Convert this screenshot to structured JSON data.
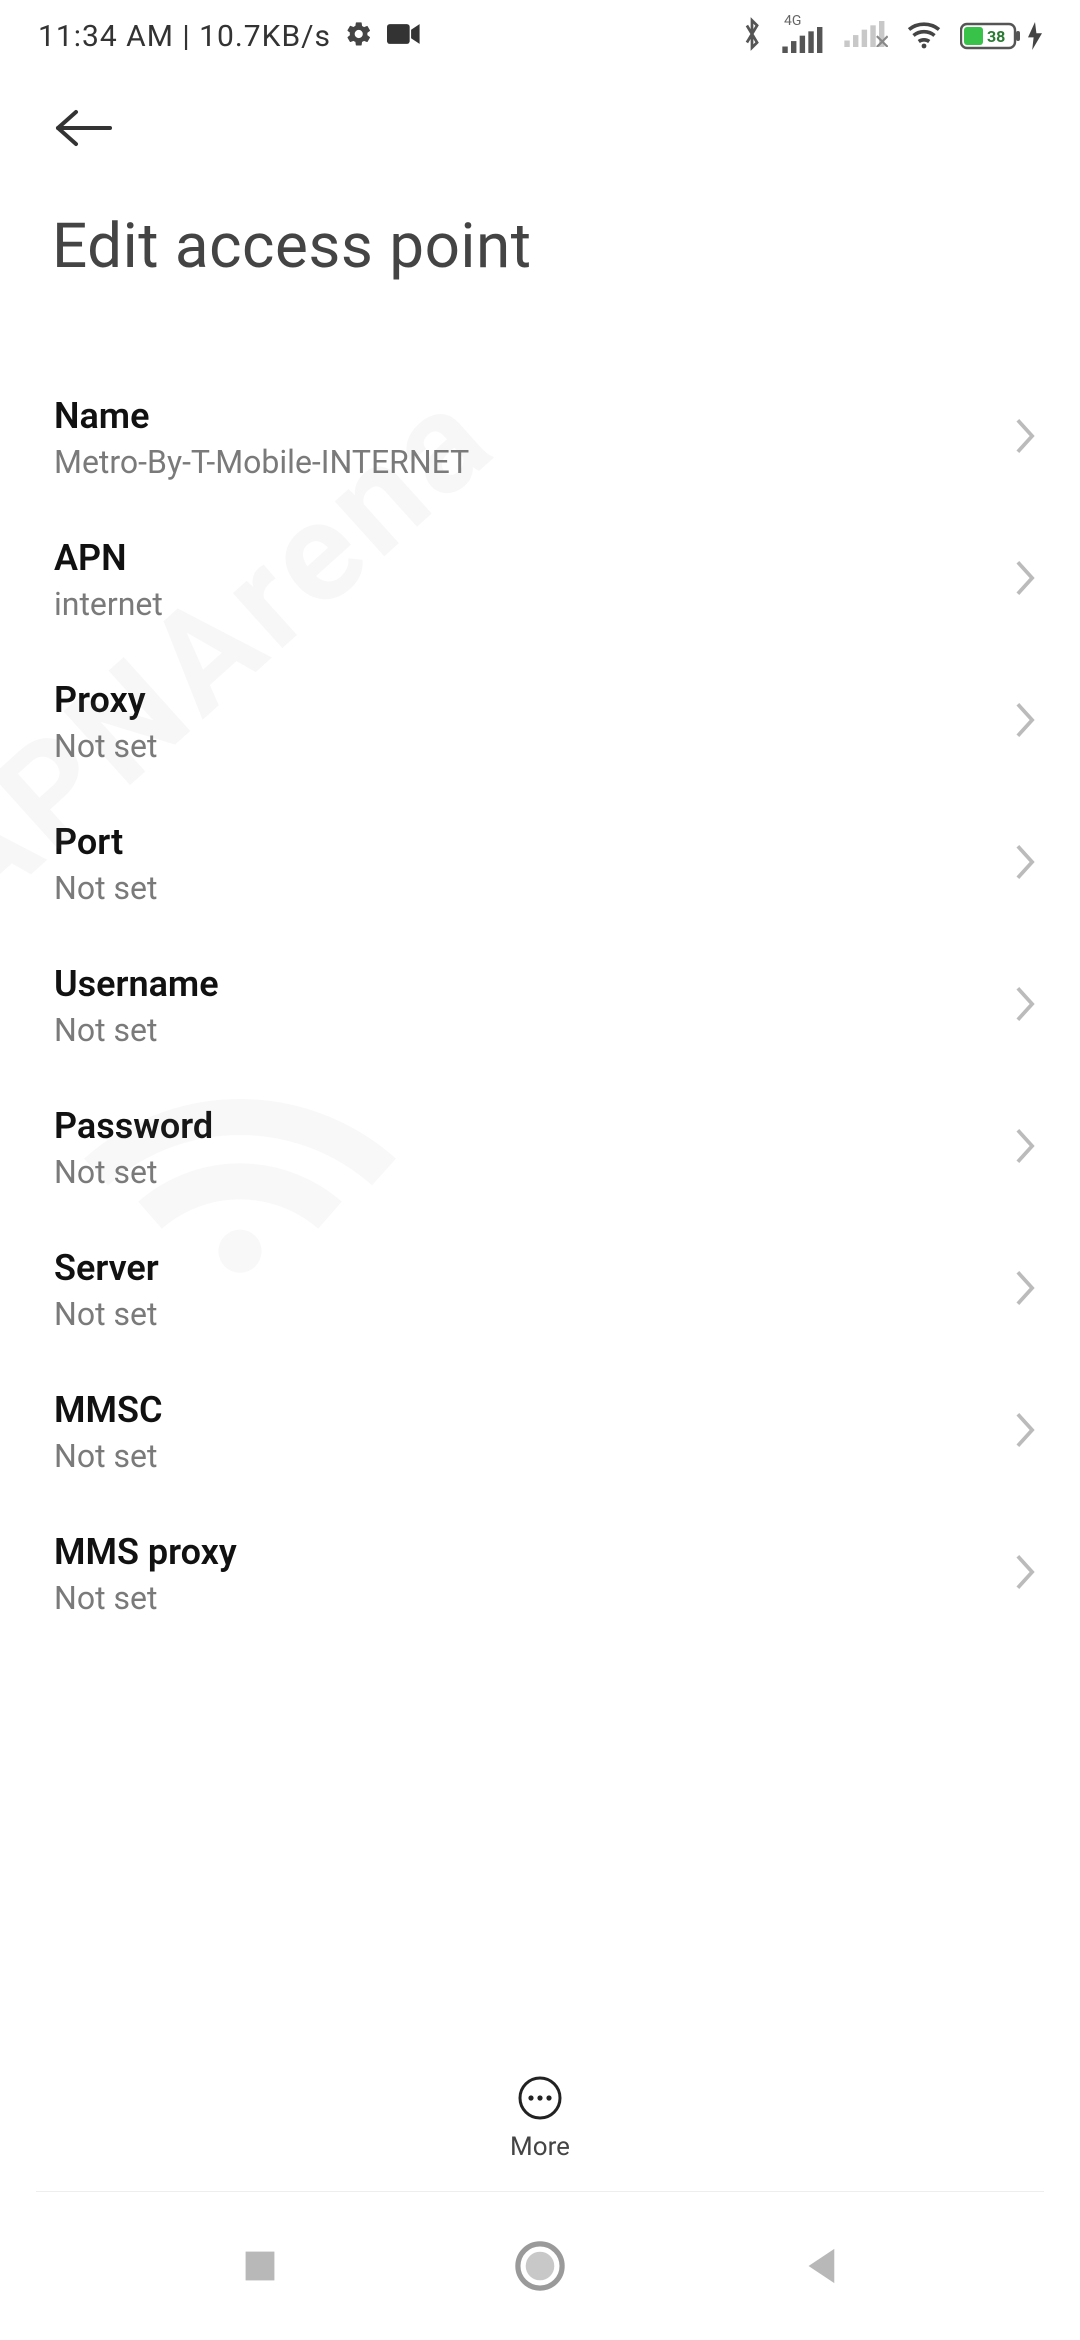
{
  "status": {
    "time": "11:34 AM",
    "net_speed": "10.7KB/s",
    "4g_label": "4G",
    "battery_pct": "38"
  },
  "header": {
    "title": "Edit access point"
  },
  "rows": [
    {
      "label": "Name",
      "value": "Metro-By-T-Mobile-INTERNET"
    },
    {
      "label": "APN",
      "value": "internet"
    },
    {
      "label": "Proxy",
      "value": "Not set"
    },
    {
      "label": "Port",
      "value": "Not set"
    },
    {
      "label": "Username",
      "value": "Not set"
    },
    {
      "label": "Password",
      "value": "Not set"
    },
    {
      "label": "Server",
      "value": "Not set"
    },
    {
      "label": "MMSC",
      "value": "Not set"
    },
    {
      "label": "MMS proxy",
      "value": "Not set"
    }
  ],
  "action_bar": {
    "more_label": "More"
  },
  "watermark": "APNArena"
}
